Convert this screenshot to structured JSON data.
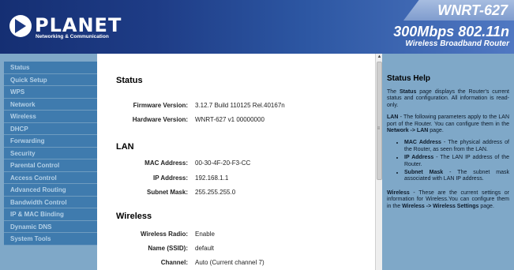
{
  "header": {
    "logo_text": "PLANET",
    "logo_sub": "Networking & Communication",
    "model": "WNRT-627",
    "speed": "300Mbps 802.11n",
    "product": "Wireless Broadband Router"
  },
  "sidebar": {
    "items": [
      {
        "label": "Status"
      },
      {
        "label": "Quick Setup"
      },
      {
        "label": "WPS"
      },
      {
        "label": "Network"
      },
      {
        "label": "Wireless"
      },
      {
        "label": "DHCP"
      },
      {
        "label": "Forwarding"
      },
      {
        "label": "Security"
      },
      {
        "label": "Parental Control"
      },
      {
        "label": "Access Control"
      },
      {
        "label": "Advanced Routing"
      },
      {
        "label": "Bandwidth Control"
      },
      {
        "label": "IP & MAC Binding"
      },
      {
        "label": "Dynamic DNS"
      },
      {
        "label": "System Tools"
      }
    ]
  },
  "main": {
    "status_title": "Status",
    "firmware_label": "Firmware Version:",
    "firmware_value": "3.12.7 Build 110125 Rel.40167n",
    "hardware_label": "Hardware Version:",
    "hardware_value": "WNRT-627 v1 00000000",
    "lan_title": "LAN",
    "mac_label": "MAC Address:",
    "mac_value": "00-30-4F-20-F3-CC",
    "ip_label": "IP Address:",
    "ip_value": "192.168.1.1",
    "mask_label": "Subnet Mask:",
    "mask_value": "255.255.255.0",
    "wireless_title": "Wireless",
    "radio_label": "Wireless Radio:",
    "radio_value": "Enable",
    "ssid_label": "Name (SSID):",
    "ssid_value": "default",
    "channel_label": "Channel:",
    "channel_value": "Auto (Current channel 7)"
  },
  "help": {
    "title": "Status Help",
    "p1_a": "The ",
    "p1_b": "Status",
    "p1_c": " page displays the Router's current status and configuration. All information is read-only.",
    "p2_a": "LAN",
    "p2_b": " - The following parameters apply to the LAN port of the Router. You can configure them in the ",
    "p2_c": "Network -> LAN",
    "p2_d": " page.",
    "li1_a": "MAC Address",
    "li1_b": " - The physical address of the Router, as seen from the LAN.",
    "li2_a": "IP Address",
    "li2_b": " - The LAN IP address of the Router.",
    "li3_a": "Subnet Mask",
    "li3_b": " - The subnet mask associated with LAN IP address.",
    "p3_a": "Wireless",
    "p3_b": " - These are the current settings or information for Wireless.You can configure them in the ",
    "p3_c": "Wireless -> Wireless Settings",
    "p3_d": " page."
  },
  "icons": {
    "logo": "planet-logo-icon",
    "scroll_up": "arrow-up-icon",
    "scroll_grip": "grip-icon"
  }
}
